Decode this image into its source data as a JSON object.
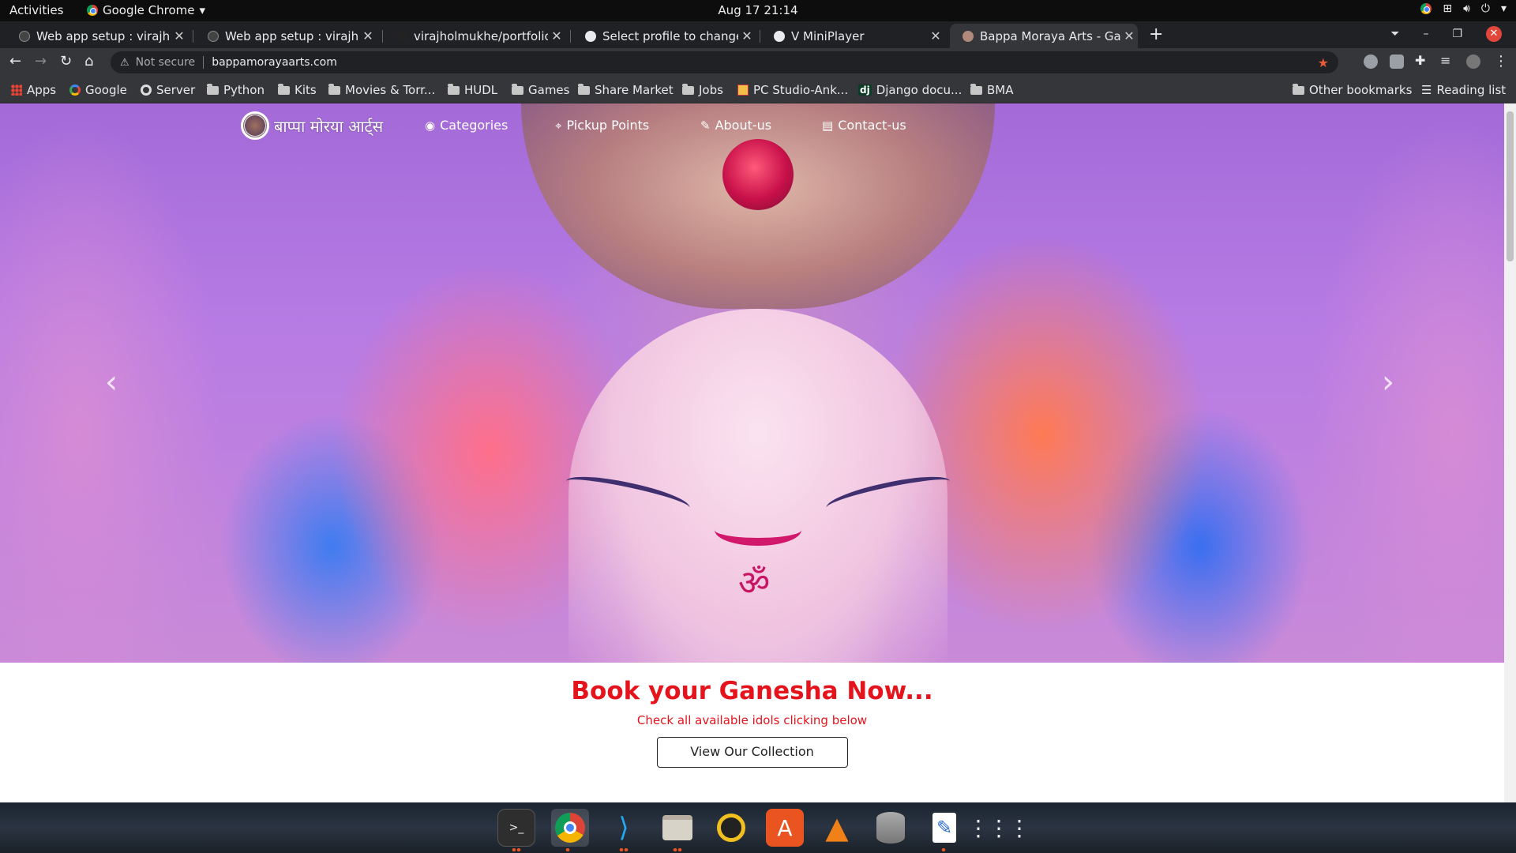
{
  "system": {
    "activities": "Activities",
    "app_menu": "Google Chrome",
    "clock": "Aug 17  21:14"
  },
  "tabs": [
    {
      "title": "Web app setup : virajholm",
      "active": false
    },
    {
      "title": "Web app setup : virajholm",
      "active": false
    },
    {
      "title": "virajholmukhe/portfolio",
      "active": false
    },
    {
      "title": "Select profile to change | ",
      "active": false
    },
    {
      "title": "V MiniPlayer",
      "active": false
    },
    {
      "title": "Bappa Moraya Arts - Ganp",
      "active": true
    }
  ],
  "omnibox": {
    "security": "Not secure",
    "url": "bappamorayaarts.com"
  },
  "bookmarks": [
    {
      "label": "Apps",
      "icon": "apps-grid-icon"
    },
    {
      "label": "Google",
      "icon": "google-icon"
    },
    {
      "label": "Server",
      "icon": "globe-icon"
    },
    {
      "label": "Python",
      "icon": "folder-icon"
    },
    {
      "label": "Kits",
      "icon": "folder-icon"
    },
    {
      "label": "Movies & Torr...",
      "icon": "folder-icon"
    },
    {
      "label": "HUDL",
      "icon": "folder-icon"
    },
    {
      "label": "Games",
      "icon": "folder-icon"
    },
    {
      "label": "Share Market",
      "icon": "folder-icon"
    },
    {
      "label": "Jobs",
      "icon": "folder-icon"
    },
    {
      "label": "PC Studio-Ank...",
      "icon": "pc-studio-icon"
    },
    {
      "label": "Django docu...",
      "icon": "django-icon"
    },
    {
      "label": "BMA",
      "icon": "folder-icon"
    }
  ],
  "bookmarks_right": {
    "other": "Other bookmarks",
    "reading": "Reading list"
  },
  "site": {
    "logo_text": "बाप्पा मोरया आर्ट्स",
    "nav": [
      {
        "label": "Categories",
        "icon": "palette-icon"
      },
      {
        "label": "Pickup Points",
        "icon": "map-pins-icon"
      },
      {
        "label": "About-us",
        "icon": "edit-icon"
      },
      {
        "label": "Contact-us",
        "icon": "contact-card-icon"
      }
    ],
    "cta_title": "Book your Ganesha Now...",
    "cta_subtitle": "Check all available idols clicking below",
    "cta_button": "View Our Collection"
  },
  "dock": [
    "terminal-icon",
    "chrome-icon",
    "vscode-icon",
    "files-icon",
    "rhythmbox-icon",
    "software-center-icon",
    "vlc-icon",
    "database-icon",
    "text-editor-icon",
    "show-apps-icon"
  ],
  "colors": {
    "accent_red": "#e5141c",
    "tab_bar": "#202124",
    "toolbar": "#35363a"
  }
}
